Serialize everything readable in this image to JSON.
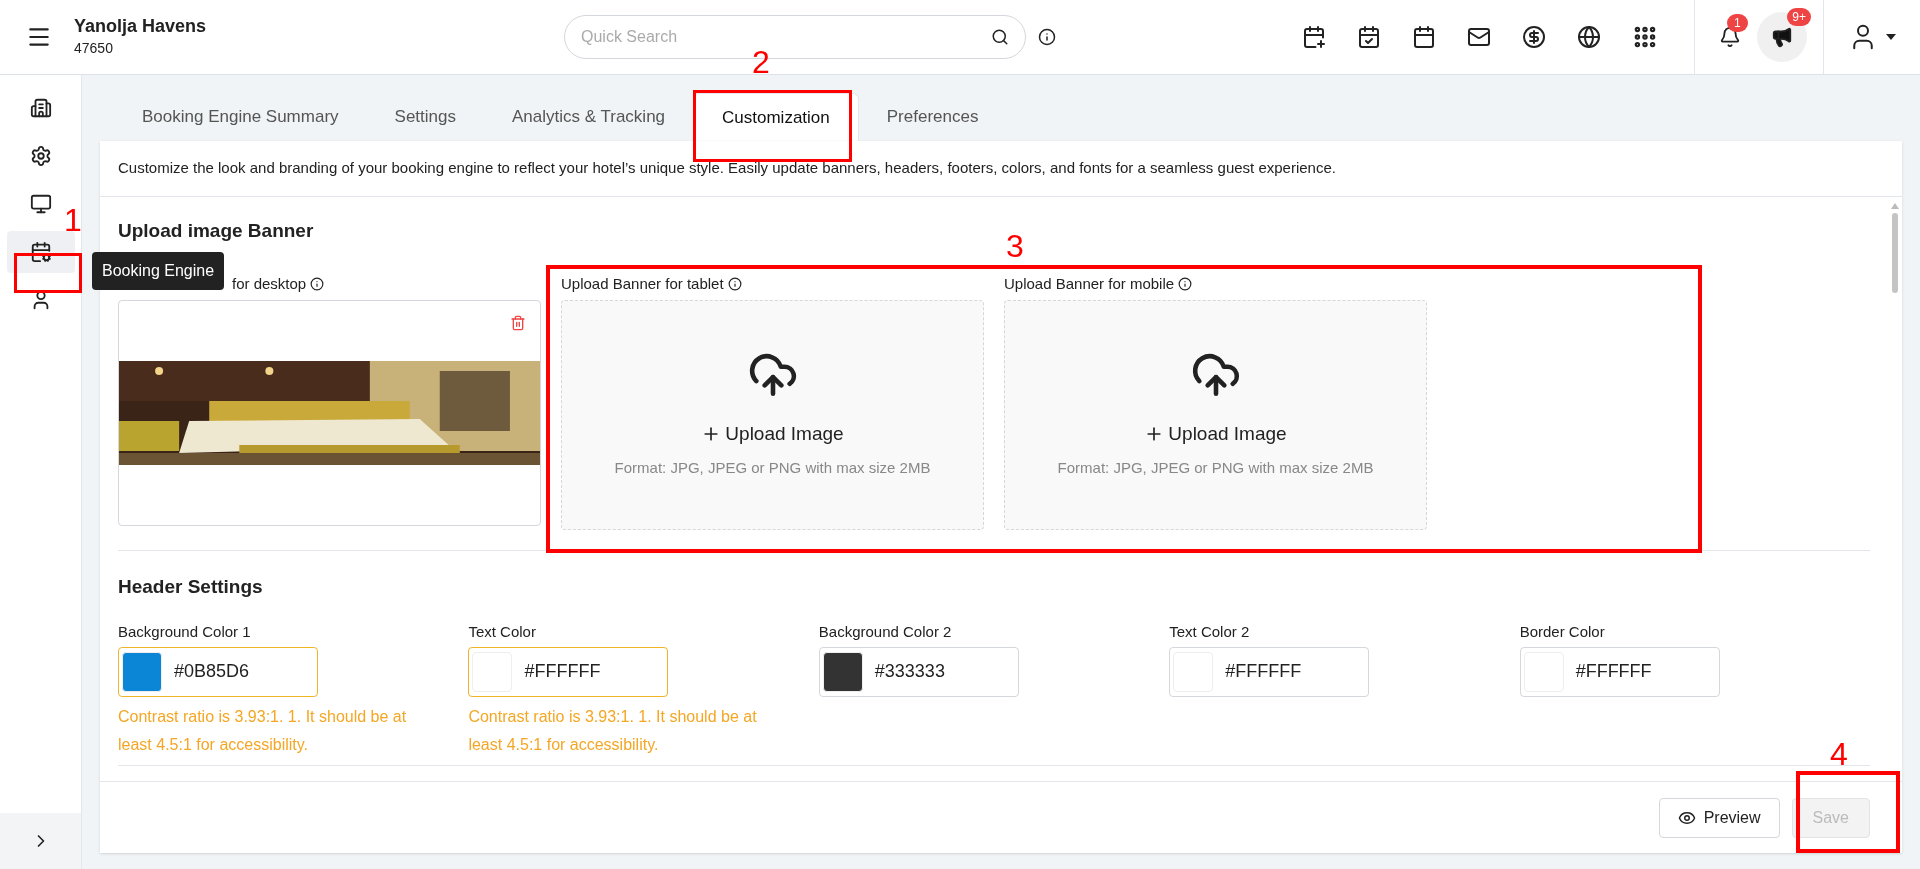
{
  "topbar": {
    "title": "Yanolja Havens",
    "code": "47650",
    "search": {
      "placeholder": "Quick Search"
    },
    "notifications_badge": "1",
    "announcements_badge": "9+"
  },
  "sidebar": {
    "items": [
      {
        "kind": "building",
        "selected": false
      },
      {
        "kind": "settings",
        "selected": false
      },
      {
        "kind": "monitor",
        "selected": false
      },
      {
        "kind": "booking",
        "selected": true
      },
      {
        "kind": "user",
        "selected": false
      }
    ],
    "tooltip": "Booking Engine"
  },
  "tabs": [
    {
      "label": "Booking Engine Summary",
      "selected": false
    },
    {
      "label": "Settings",
      "selected": false
    },
    {
      "label": "Analytics & Tracking",
      "selected": false
    },
    {
      "label": "Customization",
      "selected": true
    },
    {
      "label": "Preferences",
      "selected": false
    }
  ],
  "description": "Customize the look and branding of your booking engine to reflect your hotel’s unique style. Easily update banners, headers, footers, colors, and fonts for a seamless guest experience.",
  "banner_section": {
    "title": "Upload image Banner",
    "banners": [
      {
        "label": "for desktop"
      },
      {
        "label": "Upload Banner for tablet",
        "kind": "empty",
        "action": "Upload Image",
        "hint": "Format: JPG, JPEG or PNG with max size 2MB"
      },
      {
        "label": "Upload Banner for mobile",
        "kind": "empty",
        "action": "Upload Image",
        "hint": "Format: JPG, JPEG or PNG with max size 2MB"
      }
    ]
  },
  "header_settings": {
    "title": "Header Settings",
    "fields": [
      {
        "label": "Background Color 1",
        "value": "#0B85D6",
        "color": "#0b85d6",
        "warning": "Contrast ratio is 3.93:1. 1. It should be at least 4.5:1 for accessibility."
      },
      {
        "label": "Text Color",
        "value": "#FFFFFF",
        "color": "#ffffff",
        "warning": "Contrast ratio is 3.93:1. 1. It should be at least 4.5:1 for accessibility."
      },
      {
        "label": "Background Color 2",
        "value": "#333333",
        "color": "#333333"
      },
      {
        "label": "Text Color 2",
        "value": "#FFFFFF",
        "color": "#ffffff"
      },
      {
        "label": "Border Color",
        "value": "#FFFFFF",
        "color": "#ffffff"
      }
    ]
  },
  "footer": {
    "preview": "Preview",
    "save": {
      "label": "Save",
      "disabled": true
    }
  },
  "annotations": [
    "1",
    "2",
    "3",
    "4"
  ]
}
